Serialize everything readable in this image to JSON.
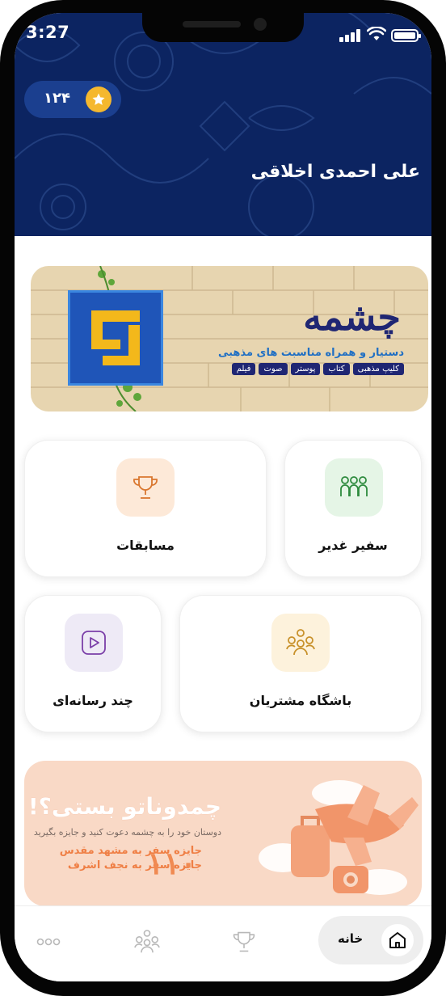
{
  "status_bar": {
    "time": "3:27"
  },
  "header": {
    "points": "۱۲۴",
    "user_name": "علی احمدی اخلاقی"
  },
  "hero_banner": {
    "brand": "چشمه",
    "subtitle": "دستیار و همراه مناسبت های مذهبی",
    "tags": [
      "فیلم",
      "صوت",
      "پوستر",
      "کتاب",
      "کلیپ مذهبی"
    ]
  },
  "cards": [
    {
      "label": "سفیر غدیر",
      "icon": "people-group-icon",
      "icon_bg": "#e5f5e6",
      "icon_color": "#2e8b3e"
    },
    {
      "label": "مسابقات",
      "icon": "trophy-icon",
      "icon_bg": "#fde9d8",
      "icon_color": "#d9772f"
    },
    {
      "label": "باشگاه مشتریان",
      "icon": "customer-club-icon",
      "icon_bg": "#fdf2dc",
      "icon_color": "#c8912a"
    },
    {
      "label": "چند رسانه‌ای",
      "icon": "play-icon",
      "icon_bg": "#eeeaf6",
      "icon_color": "#7b3fa8"
    }
  ],
  "promo_banner": {
    "title": "چمدوناتو بستی؟!",
    "subtitle": "دوستان خود را به چشمه دعوت کنید و جایزه بگیرید",
    "number": "۱۱۰",
    "prize_1": "جایزه سفر به مشهد مقدس",
    "prize_2": "جایزه سفر به نجف اشرف"
  },
  "bottom_nav": {
    "home_label": "خانه",
    "items": [
      "home-icon",
      "trophy-icon",
      "customer-club-icon",
      "more-icon"
    ]
  },
  "colors": {
    "header_bg": "#0c2461",
    "star": "#f5b82e",
    "accent_orange": "#f08a52"
  }
}
